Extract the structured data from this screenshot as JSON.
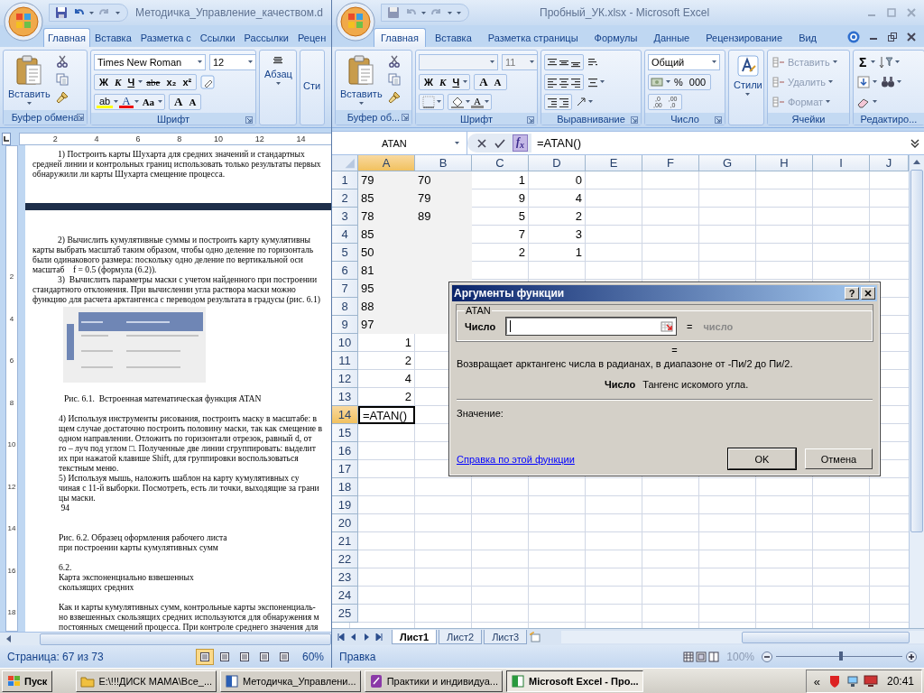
{
  "word": {
    "title": "Методичка_Управление_качеством.d",
    "tabs": [
      {
        "label": "Главная",
        "selected": true
      },
      {
        "label": "Вставка",
        "selected": false
      },
      {
        "label": "Разметка с",
        "selected": false
      },
      {
        "label": "Ссылки",
        "selected": false
      },
      {
        "label": "Рассылки",
        "selected": false
      },
      {
        "label": "Рецен",
        "selected": false
      }
    ],
    "clipboard": {
      "paste": "Вставить",
      "label": "Буфер обмена"
    },
    "font": {
      "family": "Times New Roman",
      "size": "12",
      "styles": [
        "Ж",
        "К",
        "Ч"
      ],
      "strike": "abe",
      "subscript": "x₂",
      "superscript": "x²",
      "highlight": "ab",
      "color_letter": "A",
      "change_case": "Aa",
      "grow": "A",
      "shrink": "A",
      "label": "Шрифт"
    },
    "paragraph": {
      "label": "Абзац"
    },
    "styles": {
      "label": "Сти"
    },
    "ruler": {
      "horizontal": [
        "2",
        "4",
        "6",
        "8",
        "10",
        "12",
        "14"
      ],
      "vertical": [
        "2",
        "4",
        "6",
        "8",
        "10",
        "12",
        "14",
        "16",
        "18"
      ]
    },
    "page1": [
      {
        "kind": "first",
        "text": "1) Построить карты Шухарта для средних значений и стандартных"
      },
      {
        "kind": "line",
        "text": "средней линии и контрольных границ использовать только результаты первых"
      },
      {
        "kind": "line",
        "text": "обнаружили ли карты Шухарта смещение процесса."
      }
    ],
    "page2": [
      {
        "kind": "indented",
        "lines": [
          "2) Вычислить кумулятивные суммы и построить карту кумулятивны",
          "карты выбрать масштаб таким образом, чтобы одно деление по горизонталь",
          "были одинакового размера: поскольку одно деление по вертикальной оси",
          "масштаб    f = 0.5 (формула (6.2))."
        ]
      },
      {
        "kind": "indented",
        "lines": [
          "3)  Вычислить параметры маски с учетом найденного при построении",
          "стандартного отклонения. При вычислении угла раствора маски можно",
          "функцию для расчета арктангенса с переводом результата в градусы (рис. 6.1)"
        ]
      },
      {
        "kind": "picture"
      },
      {
        "kind": "caption",
        "lines": [
          "Рис. 6.1.  Встроенная математическая функция ATAN"
        ]
      },
      {
        "kind": "block",
        "lines": [
          "4) Используя инструменты рисования, построить маску в масштабе: в",
          "щем случае достаточно построить половину маски, так как смещение в",
          "одном направлении. Отложить по горизонтали отрезок, равный d, от",
          "го – луч под углом □. Полученные две линии сгруппировать: выделит",
          "их при нажатой клавише Shift, для группировки воспользоваться",
          "текстным меню.",
          "5) Используя мышь, наложить шаблон на карту кумулятивных су",
          "чиная с 11-й выборки. Посмотреть, есть ли точки, выходящие за грани",
          "цы маски.",
          " 94"
        ]
      },
      {
        "kind": "section",
        "lines": [
          "Рис. 6.2. Образец оформления рабочего листа",
          "при построении карты кумулятивных сумм"
        ]
      },
      {
        "kind": "block",
        "lines": [
          "6.2.",
          "Карта экспоненциально взвешенных",
          "скользящих средних"
        ]
      },
      {
        "kind": "block",
        "lines": [
          "Как и карты кумулятивных сумм, контрольные карты экспоненциаль-",
          "но взвешенных скользящих средних используются для обнаружения м",
          "постоянных смещений процесса. При контроле среднего значения для"
        ]
      }
    ],
    "status": {
      "page": "Страница: 67 из 73",
      "views": [
        {
          "selected": true
        },
        {
          "selected": false
        },
        {
          "selected": false
        },
        {
          "selected": false
        },
        {
          "selected": false
        }
      ],
      "zoom": "60%"
    }
  },
  "excel": {
    "title": "Пробный_УК.xlsx - Microsoft Excel",
    "tabs": [
      {
        "label": "Главная",
        "selected": true
      },
      {
        "label": "Вставка",
        "selected": false
      },
      {
        "label": "Разметка страницы",
        "selected": false
      },
      {
        "label": "Формулы",
        "selected": false
      },
      {
        "label": "Данные",
        "selected": false
      },
      {
        "label": "Рецензирование",
        "selected": false
      },
      {
        "label": "Вид",
        "selected": false
      }
    ],
    "clipboard": {
      "paste": "Вставить",
      "label": "Буфер об..."
    },
    "font": {
      "size": "11",
      "styles": [
        "Ж",
        "К",
        "Ч"
      ],
      "grow": "A",
      "shrink": "A",
      "color_letter": "A",
      "label": "Шрифт"
    },
    "alignment": {
      "label": "Выравнивание"
    },
    "number": {
      "format": "Общий",
      "percent": "%",
      "thousands": "000",
      "decimals": [
        {
          "top": ",0",
          "bottom": ",00"
        },
        {
          "top": ",00",
          "bottom": ",0"
        }
      ],
      "label": "Число"
    },
    "styles": {
      "button": "Стили"
    },
    "cells": {
      "buttons": [
        {
          "label": "Вставить",
          "disabled": true
        },
        {
          "label": "Удалить",
          "disabled": true
        },
        {
          "label": "Формат",
          "disabled": true
        }
      ],
      "label": "Ячейки"
    },
    "editing": {
      "sum": "Σ",
      "label": "Редактиро..."
    },
    "name_box": "ATAN",
    "fx": "f$_{x}$",
    "formula": "=ATAN()",
    "columns": [
      {
        "label": "A",
        "selected": true
      },
      {
        "label": "B",
        "selected": false
      },
      {
        "label": "C",
        "selected": false
      },
      {
        "label": "D",
        "selected": false
      },
      {
        "label": "E",
        "selected": false
      },
      {
        "label": "F",
        "selected": false
      },
      {
        "label": "G",
        "selected": false
      },
      {
        "label": "H",
        "selected": false
      },
      {
        "label": "I",
        "selected": false
      },
      {
        "label": "J",
        "selected": false
      }
    ],
    "rows": [
      {
        "number": "1",
        "selected": false,
        "cells": [
          {
            "text": "79",
            "kind": "text",
            "shaded": true,
            "active": false
          },
          {
            "text": "70",
            "kind": "text",
            "shaded": true,
            "active": false
          },
          {
            "text": "1",
            "kind": "number",
            "shaded": false,
            "active": false
          },
          {
            "text": "0",
            "kind": "number",
            "shaded": false,
            "active": false
          }
        ]
      },
      {
        "number": "2",
        "selected": false,
        "cells": [
          {
            "text": "85",
            "kind": "text",
            "shaded": true,
            "active": false
          },
          {
            "text": "79",
            "kind": "text",
            "shaded": true,
            "active": false
          },
          {
            "text": "9",
            "kind": "number",
            "shaded": false,
            "active": false
          },
          {
            "text": "4",
            "kind": "number",
            "shaded": false,
            "active": false
          }
        ]
      },
      {
        "number": "3",
        "selected": false,
        "cells": [
          {
            "text": "78",
            "kind": "text",
            "shaded": true,
            "active": false
          },
          {
            "text": "89",
            "kind": "text",
            "shaded": true,
            "active": false
          },
          {
            "text": "5",
            "kind": "number",
            "shaded": false,
            "active": false
          },
          {
            "text": "2",
            "kind": "number",
            "shaded": false,
            "active": false
          }
        ]
      },
      {
        "number": "4",
        "selected": false,
        "cells": [
          {
            "text": "85",
            "kind": "text",
            "shaded": true,
            "active": false
          },
          {
            "kind": "empty",
            "shaded": true,
            "active": false
          },
          {
            "text": "7",
            "kind": "number",
            "shaded": false,
            "active": false
          },
          {
            "text": "3",
            "kind": "number",
            "shaded": false,
            "active": false
          }
        ]
      },
      {
        "number": "5",
        "selected": false,
        "cells": [
          {
            "text": "50",
            "kind": "text",
            "shaded": true,
            "active": false
          },
          {
            "kind": "empty",
            "shaded": true,
            "active": false
          },
          {
            "text": "2",
            "kind": "number",
            "shaded": false,
            "active": false
          },
          {
            "text": "1",
            "kind": "number",
            "shaded": false,
            "active": false
          }
        ]
      },
      {
        "number": "6",
        "selected": false,
        "cells": [
          {
            "text": "81",
            "kind": "text",
            "shaded": true,
            "active": false
          },
          {
            "kind": "empty",
            "shaded": true,
            "active": false
          }
        ]
      },
      {
        "number": "7",
        "selected": false,
        "cells": [
          {
            "text": "95",
            "kind": "text",
            "shaded": true,
            "active": false
          },
          {
            "kind": "empty",
            "shaded": true,
            "active": false
          }
        ]
      },
      {
        "number": "8",
        "selected": false,
        "cells": [
          {
            "text": "88",
            "kind": "text",
            "shaded": true,
            "active": false
          },
          {
            "kind": "empty",
            "shaded": true,
            "active": false
          }
        ]
      },
      {
        "number": "9",
        "selected": false,
        "cells": [
          {
            "text": "97",
            "kind": "text",
            "shaded": true,
            "active": false
          },
          {
            "kind": "empty",
            "shaded": true,
            "active": false
          }
        ]
      },
      {
        "number": "10",
        "selected": false,
        "cells": [
          {
            "text": "1",
            "kind": "number",
            "shaded": false,
            "active": false
          }
        ]
      },
      {
        "number": "11",
        "selected": false,
        "cells": [
          {
            "text": "2",
            "kind": "number",
            "shaded": false,
            "active": false
          }
        ]
      },
      {
        "number": "12",
        "selected": false,
        "cells": [
          {
            "text": "4",
            "kind": "number",
            "shaded": false,
            "active": false
          }
        ]
      },
      {
        "number": "13",
        "selected": false,
        "cells": [
          {
            "text": "2",
            "kind": "number",
            "shaded": false,
            "active": false
          }
        ]
      },
      {
        "number": "14",
        "selected": true,
        "cells": [
          {
            "text": "=ATAN()",
            "kind": "text",
            "shaded": false,
            "active": true
          }
        ]
      },
      {
        "number": "15",
        "selected": false,
        "cells": []
      },
      {
        "number": "16",
        "selected": false,
        "cells": []
      },
      {
        "number": "17",
        "selected": false,
        "cells": []
      },
      {
        "number": "18",
        "selected": false,
        "cells": []
      },
      {
        "number": "19",
        "selected": false,
        "cells": []
      },
      {
        "number": "20",
        "selected": false,
        "cells": []
      },
      {
        "number": "21",
        "selected": false,
        "cells": []
      },
      {
        "number": "22",
        "selected": false,
        "cells": []
      },
      {
        "number": "23",
        "selected": false,
        "cells": []
      },
      {
        "number": "24",
        "selected": false,
        "cells": []
      },
      {
        "number": "25",
        "selected": false,
        "cells": []
      }
    ],
    "sheets": [
      {
        "label": "Лист1",
        "selected": true
      },
      {
        "label": "Лист2",
        "selected": false
      },
      {
        "label": "Лист3",
        "selected": false
      }
    ],
    "status": {
      "mode": "Правка",
      "zoom": "100%",
      "zoom_slider": {
        "level": 0.5
      }
    },
    "dialog": {
      "title": "Аргументы функции",
      "help": "?",
      "function": "ATAN",
      "arg_label": "Число",
      "equals": "=",
      "arg_hint": "число",
      "result_equals": "=",
      "description": "Возвращает арктангенс числа в радианах, в диапазоне от -Пи/2 до Пи/2.",
      "arg_name": "Число",
      "arg_description": "Тангенс искомого угла.",
      "value_label": "Значение:",
      "help_link": "Справка по этой функции",
      "buttons": [
        {
          "label": "OK",
          "default": true
        },
        {
          "label": "Отмена",
          "default": false
        }
      ]
    }
  },
  "taskbar": {
    "start": "Пуск",
    "tasks": [
      {
        "label": "E:\\!!!ДИСК МАМА\\Все_...",
        "selected": false
      },
      {
        "label": "Методичка_Управлени...",
        "selected": false
      },
      {
        "label": "Практики и индивидуа...",
        "selected": false
      },
      {
        "label": "Microsoft Excel - Про...",
        "selected": true
      }
    ],
    "tray": "«",
    "time": "20:41"
  }
}
